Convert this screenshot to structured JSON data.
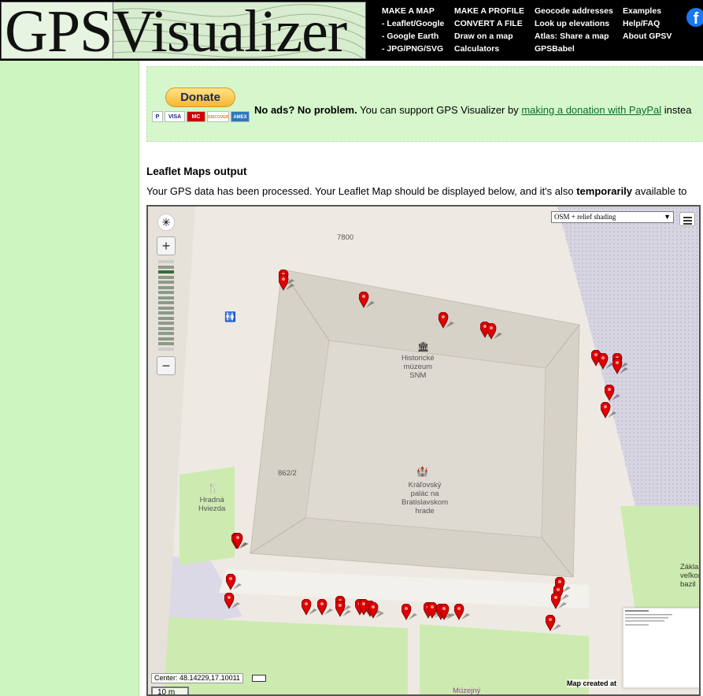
{
  "header": {
    "logo_text": "GPSVisualizer",
    "menu_columns": [
      [
        "MAKE A MAP",
        "- Leaflet/Google",
        "- Google Earth",
        "- JPG/PNG/SVG"
      ],
      [
        "MAKE A PROFILE",
        "CONVERT A FILE",
        "Draw on a map",
        "Calculators"
      ],
      [
        "Geocode addresses",
        "Look up elevations",
        "Atlas: Share a map",
        "GPSBabel"
      ],
      [
        "Examples",
        "Help/FAQ",
        "About GPSV"
      ]
    ],
    "facebook_icon": "f"
  },
  "donate": {
    "button_label": "Donate",
    "cards": [
      "P",
      "VISA",
      "MC",
      "DISCOVER",
      "AMEX"
    ],
    "lead": "No ads? No problem.",
    "text": " You can support GPS Visualizer by ",
    "link": "making a donation with PayPal",
    "tail": " instea"
  },
  "output": {
    "title": "Leaflet Maps output",
    "desc_start": "Your GPS data has been processed. Your Leaflet Map should be displayed below, and it's also ",
    "desc_bold": "temporarily",
    "desc_end": " available to"
  },
  "map": {
    "layer_selected": "OSM + relief shading",
    "center": "Center: 48.14229,17.10011",
    "scale": "10 m",
    "credit": "Map created at",
    "labels": {
      "house_number_top": "7800",
      "parcel": "862/2",
      "museum": "Historické\nmúzeum\nSNM",
      "palace": "Kráľovský\npalác na\nBratislavskom\nhrade",
      "restaurant": "Hradná\nHviezda",
      "right_edge": "Zákla\nveľkomo\nbazil",
      "bottom": "Múzejný"
    },
    "zoom_in": "+",
    "zoom_out": "−"
  },
  "colors": {
    "accent_green": "#ccf5bf",
    "marker_red": "#e00000",
    "link_green": "#0a6e2a"
  }
}
